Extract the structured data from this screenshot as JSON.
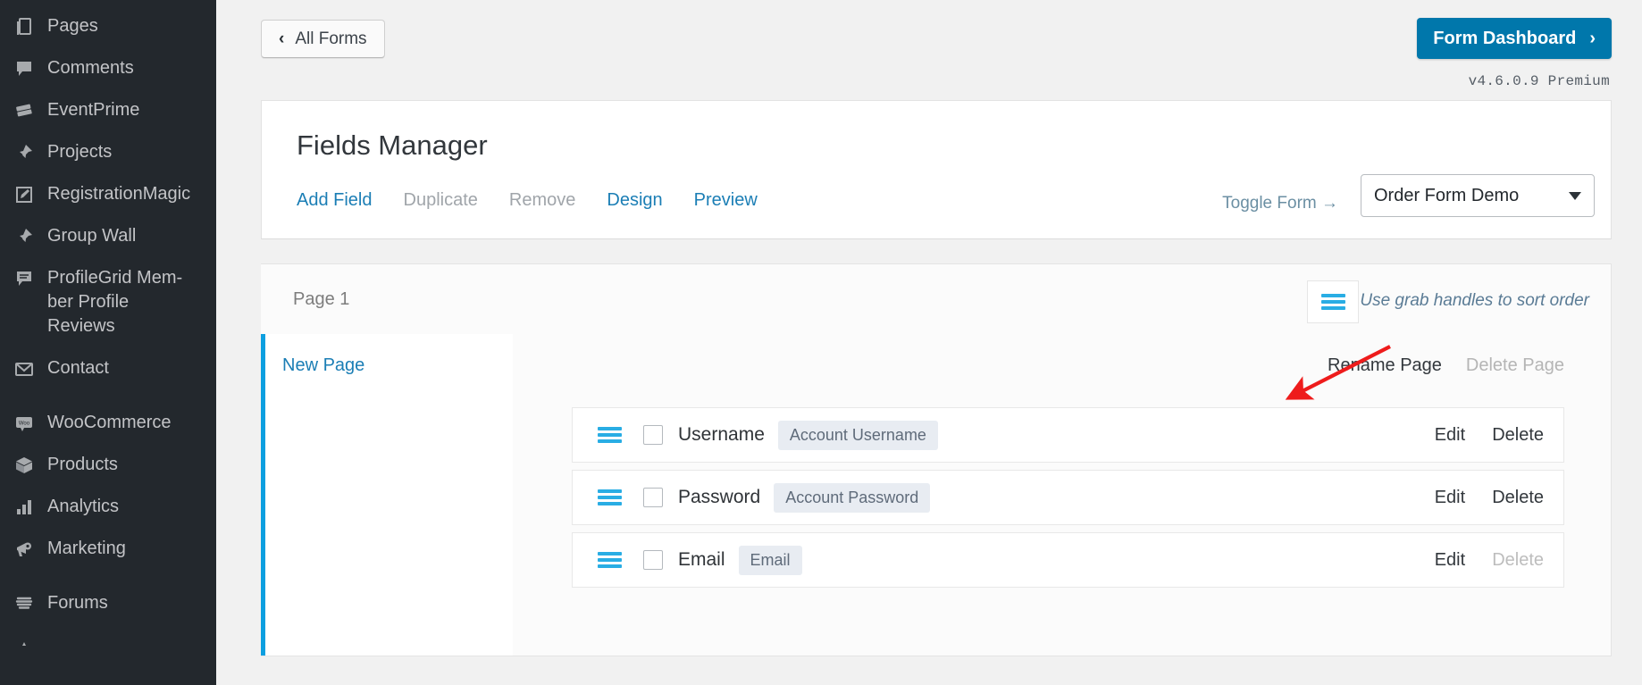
{
  "sidebar": {
    "items": [
      {
        "label": "Pages",
        "icon": "pages-icon"
      },
      {
        "label": "Comments",
        "icon": "comments-icon"
      },
      {
        "label": "EventPrime",
        "icon": "eventprime-icon"
      },
      {
        "label": "Projects",
        "icon": "pin-icon"
      },
      {
        "label": "RegistrationMagic",
        "icon": "registrationmagic-icon"
      },
      {
        "label": "Group Wall",
        "icon": "pin-icon"
      },
      {
        "label": "ProfileGrid Mem-\nber Profile\nReviews",
        "icon": "profilegrid-icon"
      },
      {
        "label": "Contact",
        "icon": "envelope-icon"
      },
      {
        "label": "WooCommerce",
        "icon": "woocommerce-icon"
      },
      {
        "label": "Products",
        "icon": "products-icon"
      },
      {
        "label": "Analytics",
        "icon": "analytics-icon"
      },
      {
        "label": "Marketing",
        "icon": "marketing-icon"
      },
      {
        "label": "Forums",
        "icon": "forums-icon"
      }
    ]
  },
  "topbar": {
    "all_forms_label": "All Forms",
    "back_chevron": "‹",
    "dashboard_label": "Form Dashboard",
    "dashboard_chevron": "›",
    "version": "v4.6.0.9 Premium",
    "accent_color": "#0077ab"
  },
  "fields_manager": {
    "title": "Fields Manager",
    "tabs": [
      {
        "label": "Add Field",
        "state": "active"
      },
      {
        "label": "Duplicate",
        "state": "disabled"
      },
      {
        "label": "Remove",
        "state": "disabled"
      },
      {
        "label": "Design",
        "state": "active"
      },
      {
        "label": "Preview",
        "state": "active"
      }
    ],
    "toggle_form_label": "Toggle Form →",
    "form_select": {
      "selected": "Order Form Demo",
      "options": [
        "Order Form Demo"
      ]
    }
  },
  "page_panel": {
    "page_label": "Page 1",
    "grab_hint": "Use grab handles to sort order",
    "new_page_label": "New Page",
    "rename_label": "Rename Page",
    "delete_label": "Delete Page",
    "accent_color": "#0c9fe0",
    "fields": [
      {
        "label": "Username",
        "badge": "Account Username",
        "edit": "Edit",
        "delete": "Delete",
        "delete_disabled": false
      },
      {
        "label": "Password",
        "badge": "Account Password",
        "edit": "Edit",
        "delete": "Delete",
        "delete_disabled": false
      },
      {
        "label": "Email",
        "badge": "Email",
        "edit": "Edit",
        "delete": "Delete",
        "delete_disabled": true
      }
    ]
  },
  "annotation": {
    "arrow_color": "#ee1c1c"
  }
}
